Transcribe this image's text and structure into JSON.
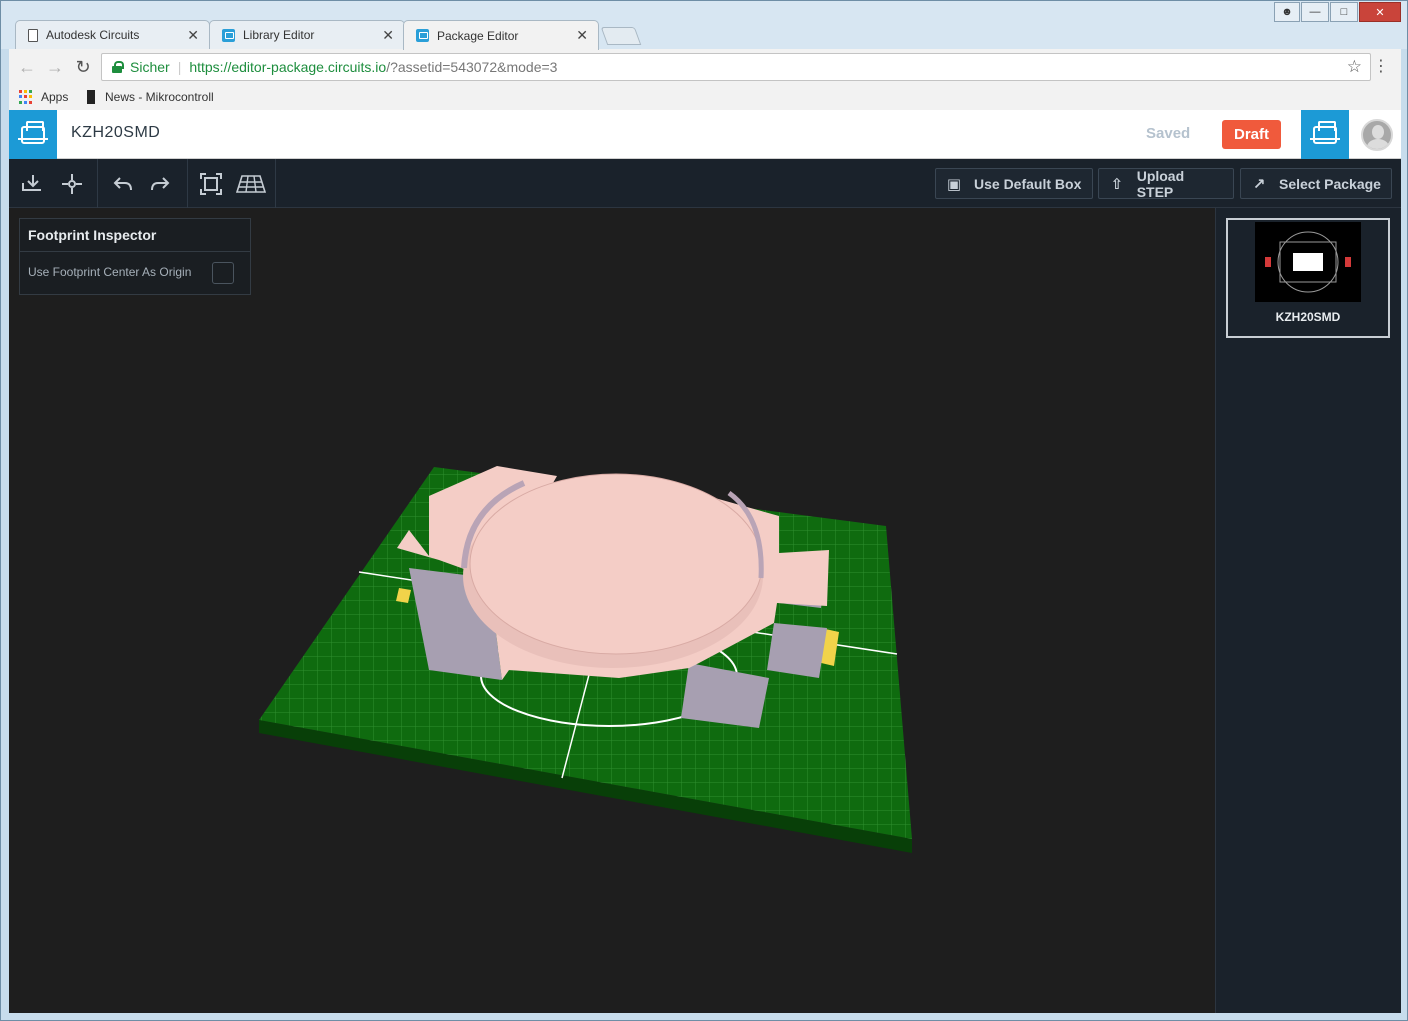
{
  "browser": {
    "tabs": [
      {
        "title": "Autodesk Circuits",
        "icon": "doc-icon"
      },
      {
        "title": "Library Editor",
        "icon": "app-icon"
      },
      {
        "title": "Package Editor",
        "icon": "app-icon",
        "active": true
      }
    ],
    "address": {
      "secure_label": "Sicher",
      "host": "https://editor-package.circuits.io",
      "path": "/?assetid=543072&mode=3"
    },
    "bookmarks": [
      {
        "label": "Apps",
        "icon": "apps-icon"
      },
      {
        "label": "News - Mikrocontroll",
        "icon": "bookmark-icon"
      }
    ]
  },
  "header": {
    "package_title": "KZH20SMD",
    "save_status": "Saved",
    "draft_label": "Draft"
  },
  "toolbar": {
    "use_default_box": "Use Default Box",
    "upload_step": "Upload STEP",
    "select_package": "Select Package"
  },
  "inspector": {
    "title": "Footprint Inspector",
    "use_center_origin_label": "Use Footprint Center As Origin",
    "use_center_origin_checked": false
  },
  "sidebar": {
    "packages": [
      {
        "name": "KZH20SMD"
      }
    ]
  },
  "colors": {
    "accent": "#1c9ad6",
    "draft": "#f05a3c",
    "board": "#0f6b0f",
    "component": "#f4cdc6",
    "component_side": "#a79fb1",
    "pad": "#f1d34a"
  }
}
